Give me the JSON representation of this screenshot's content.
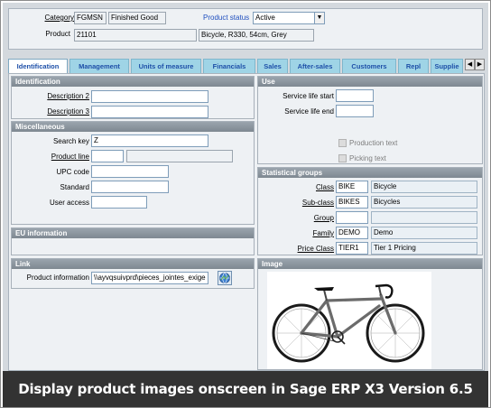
{
  "header": {
    "category_label": "Category",
    "category_code": "FGMSN",
    "category_desc": "Finished Good",
    "product_status_label": "Product status",
    "product_status_value": "Active",
    "product_label": "Product",
    "product_code": "21101",
    "product_desc": "Bicycle, R330, 54cm, Grey"
  },
  "tabs": [
    "Identification",
    "Management",
    "Units of measure",
    "Financials",
    "Sales",
    "After-sales",
    "Customers",
    "Repl",
    "Supplie"
  ],
  "identification": {
    "title": "Identification",
    "description2_label": "Description 2",
    "description2_value": "",
    "description3_label": "Description 3",
    "description3_value": ""
  },
  "misc": {
    "title": "Miscellaneous",
    "search_key_label": "Search key",
    "search_key_value": "Z",
    "product_line_label": "Product line",
    "product_line_code": "",
    "product_line_desc": "",
    "upc_label": "UPC code",
    "upc_value": "",
    "standard_label": "Standard",
    "standard_value": "",
    "user_access_label": "User access",
    "user_access_value": ""
  },
  "eu": {
    "title": "EU information"
  },
  "link": {
    "title": "Link",
    "product_info_label": "Product information",
    "product_info_value": "\\\\ayvqsuivprd\\pieces_jointes_exige"
  },
  "use": {
    "title": "Use",
    "service_life_start_label": "Service life start",
    "service_life_start_value": "",
    "service_life_end_label": "Service life end",
    "service_life_end_value": "",
    "production_text_label": "Production text",
    "picking_text_label": "Picking text"
  },
  "stat": {
    "title": "Statistical groups",
    "rows": [
      {
        "label": "Class",
        "code": "BIKE",
        "desc": "Bicycle"
      },
      {
        "label": "Sub-class",
        "code": "BIKES",
        "desc": "Bicycles"
      },
      {
        "label": "Group",
        "code": "",
        "desc": ""
      },
      {
        "label": "Family",
        "code": "DEMO",
        "desc": "Demo"
      },
      {
        "label": "Price Class",
        "code": "TIER1",
        "desc": "Tier 1 Pricing"
      }
    ]
  },
  "image": {
    "title": "Image"
  },
  "caption": "Display product images onscreen in Sage ERP X3 Version 6.5",
  "icons": {
    "dropdown": "chevron-down-icon",
    "tab_prev": "chevron-left-icon",
    "tab_next": "chevron-right-icon",
    "open_link": "globe-icon",
    "product_picture": "bicycle-image"
  },
  "colors": {
    "tab_background": "#9fd4e6",
    "tab_text": "#1d4fa8",
    "panel_title": "#8a949d",
    "caption_background": "#333333"
  }
}
